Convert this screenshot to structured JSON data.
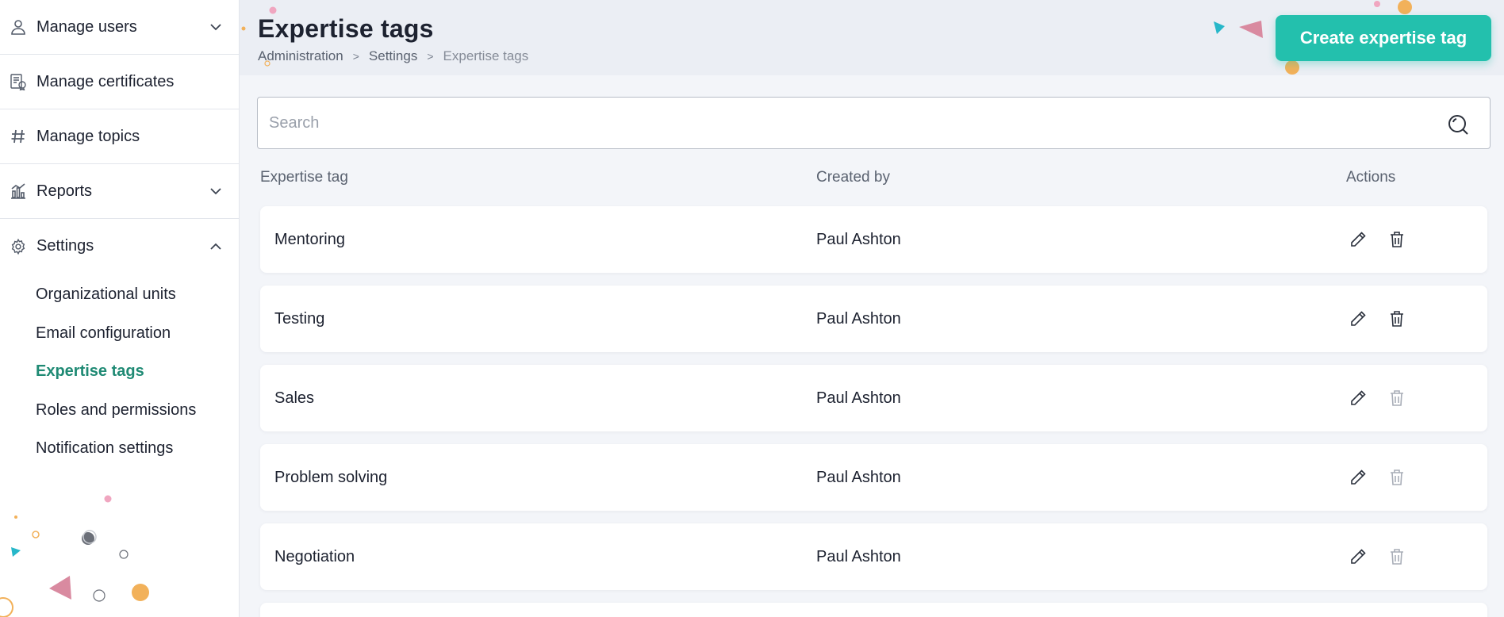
{
  "sidebar": {
    "items": [
      {
        "label": "Manage users",
        "icon": "user-icon",
        "expandable": true,
        "expanded": false
      },
      {
        "label": "Manage certificates",
        "icon": "certificate-icon",
        "expandable": false
      },
      {
        "label": "Manage topics",
        "icon": "hash-icon",
        "expandable": false
      },
      {
        "label": "Reports",
        "icon": "chart-icon",
        "expandable": true,
        "expanded": false
      },
      {
        "label": "Settings",
        "icon": "gear-icon",
        "expandable": true,
        "expanded": true
      }
    ],
    "settings_sub": [
      {
        "label": "Organizational units",
        "active": false
      },
      {
        "label": "Email configuration",
        "active": false
      },
      {
        "label": "Expertise tags",
        "active": true
      },
      {
        "label": "Roles and permissions",
        "active": false
      },
      {
        "label": "Notification settings",
        "active": false
      }
    ]
  },
  "header": {
    "title": "Expertise tags",
    "breadcrumb": [
      "Administration",
      "Settings",
      "Expertise tags"
    ],
    "create_button": "Create expertise tag"
  },
  "search": {
    "placeholder": "Search",
    "value": ""
  },
  "table": {
    "columns": [
      "Expertise tag",
      "Created by",
      "Actions"
    ],
    "rows": [
      {
        "tag": "Mentoring",
        "created_by": "Paul Ashton",
        "delete_enabled": true
      },
      {
        "tag": "Testing",
        "created_by": "Paul Ashton",
        "delete_enabled": true
      },
      {
        "tag": "Sales",
        "created_by": "Paul Ashton",
        "delete_enabled": false
      },
      {
        "tag": "Problem solving",
        "created_by": "Paul Ashton",
        "delete_enabled": false
      },
      {
        "tag": "Negotiation",
        "created_by": "Paul Ashton",
        "delete_enabled": false
      }
    ]
  },
  "colors": {
    "accent": "#23c0ad",
    "active_nav": "#1f8a74",
    "deco_pink": "#d98aa0",
    "deco_orange": "#f2b15a",
    "deco_teal": "#27b7c9"
  }
}
